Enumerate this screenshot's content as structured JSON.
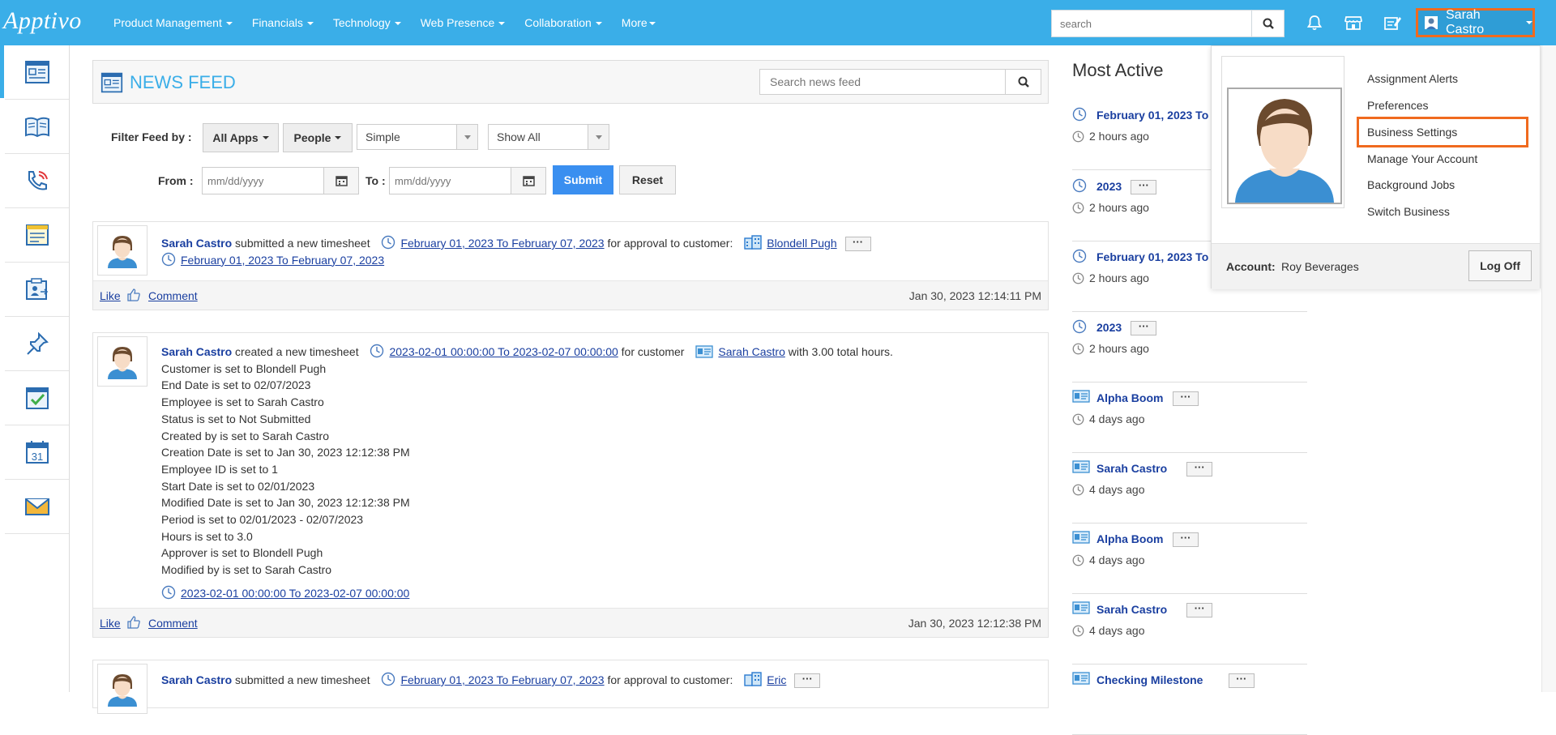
{
  "app": {
    "logo": "Apptivo"
  },
  "nav": {
    "items": [
      {
        "label": "Product Management"
      },
      {
        "label": "Financials"
      },
      {
        "label": "Technology"
      },
      {
        "label": "Web Presence"
      },
      {
        "label": "Collaboration"
      },
      {
        "label": "More"
      }
    ],
    "search_placeholder": "search",
    "user_name": "Sarah Castro"
  },
  "colors": {
    "brand": "#3aaee8",
    "highlight": "#f06a1e",
    "link": "#1a3fa0",
    "submit": "#3a8ff0"
  },
  "sidebar": {
    "icons": [
      "news-feed-icon",
      "address-book-icon",
      "call-log-icon",
      "notes-icon",
      "contact-transfer-icon",
      "pin-icon",
      "tasks-check-icon",
      "calendar-icon",
      "email-icon"
    ],
    "calendar_day": "31"
  },
  "feed": {
    "title": "NEWS FEED",
    "search_placeholder": "Search news feed",
    "filter_label": "Filter Feed by :",
    "all_apps": "All Apps",
    "people": "People",
    "view_select": "Simple",
    "show_select": "Show All",
    "from_label": "From :",
    "to_label": "To :",
    "date_placeholder": "mm/dd/yyyy",
    "submit": "Submit",
    "reset": "Reset"
  },
  "posts": [
    {
      "user": "Sarah Castro",
      "action": "submitted a new timesheet",
      "link1": "February 01, 2023 To February 07, 2023",
      "mid": "for approval to customer:",
      "link2": "Blondell Pugh",
      "sub_link": "February 01, 2023 To February 07, 2023",
      "like": "Like",
      "comment": "Comment",
      "time": "Jan 30, 2023 12:14:11 PM"
    },
    {
      "user": "Sarah Castro",
      "action": "created a new timesheet",
      "link1": "2023-02-01 00:00:00 To 2023-02-07 00:00:00",
      "mid": "for customer",
      "link2": "Sarah Castro",
      "tail": "with 3.00 total hours.",
      "details": [
        "Customer is set to Blondell Pugh",
        "End Date is set to 02/07/2023",
        "Employee is set to Sarah Castro",
        "Status is set to Not Submitted",
        "Created by is set to Sarah Castro",
        "Creation Date is set to Jan 30, 2023 12:12:38 PM",
        "Employee ID is set to 1",
        "Start Date is set to 02/01/2023",
        "Modified Date is set to Jan 30, 2023 12:12:38 PM",
        "Period is set to 02/01/2023 - 02/07/2023",
        "Hours is set to 3.0",
        "Approver is set to Blondell Pugh",
        "Modified by is set to Sarah Castro"
      ],
      "sub_link": "2023-02-01 00:00:00 To 2023-02-07 00:00:00",
      "like": "Like",
      "comment": "Comment",
      "time": "Jan 30, 2023 12:12:38 PM"
    },
    {
      "user": "Sarah Castro",
      "action": "submitted a new timesheet",
      "link1": "February 01, 2023 To February 07, 2023",
      "mid": "for approval to customer:",
      "link2": "Eric"
    }
  ],
  "most_active": {
    "title": "Most Active",
    "items": [
      {
        "name": "February 01, 2023 To",
        "ago": "2 hours ago",
        "icon": "clock-icon"
      },
      {
        "name": "2023",
        "ago": "2 hours ago",
        "icon": "clock-icon"
      },
      {
        "name": "February 01, 2023 To",
        "ago": "2 hours ago",
        "icon": "clock-icon"
      },
      {
        "name": "2023",
        "ago": "2 hours ago",
        "icon": "clock-icon"
      },
      {
        "name": "Alpha Boom",
        "ago": "4 days ago",
        "icon": "contact-card-icon"
      },
      {
        "name": "Sarah Castro",
        "ago": "4 days ago",
        "icon": "contact-card-icon"
      },
      {
        "name": "Alpha Boom",
        "ago": "4 days ago",
        "icon": "contact-card-icon"
      },
      {
        "name": "Sarah Castro",
        "ago": "4 days ago",
        "icon": "contact-card-icon"
      },
      {
        "name": "Checking Milestone",
        "ago": "",
        "icon": "contact-card-icon"
      }
    ]
  },
  "user_menu": {
    "items": [
      "Assignment Alerts",
      "Preferences",
      "Business Settings",
      "Manage Your Account",
      "Background Jobs",
      "Switch Business"
    ],
    "account_label": "Account:",
    "account_value": "Roy Beverages",
    "logoff": "Log Off"
  }
}
